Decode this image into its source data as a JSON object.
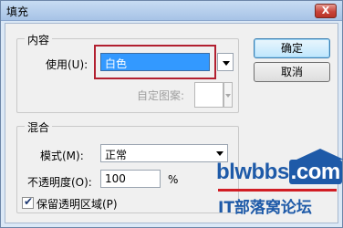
{
  "window": {
    "title": "填充",
    "close_label": "X"
  },
  "content_group": {
    "legend": "内容",
    "use_label": "使用(U):",
    "use_value": "白色",
    "pattern_label": "自定图案:"
  },
  "blend_group": {
    "legend": "混合",
    "mode_label": "模式(M):",
    "mode_value": "正常",
    "opacity_label": "不透明度(O):",
    "opacity_value": "100",
    "opacity_unit": "%",
    "preserve_label": "保留透明区域(P)",
    "preserve_checked": true
  },
  "buttons": {
    "ok": "确定",
    "cancel": "取消"
  },
  "watermark": {
    "domain_main": "blwbbs",
    "domain_tld": ".com",
    "text": "IT部落窝论坛"
  },
  "colors": {
    "selection": "#3399ff",
    "highlight_box": "#b22030",
    "brand_blue": "#1e5aa8",
    "brand_red": "#d11d24"
  }
}
